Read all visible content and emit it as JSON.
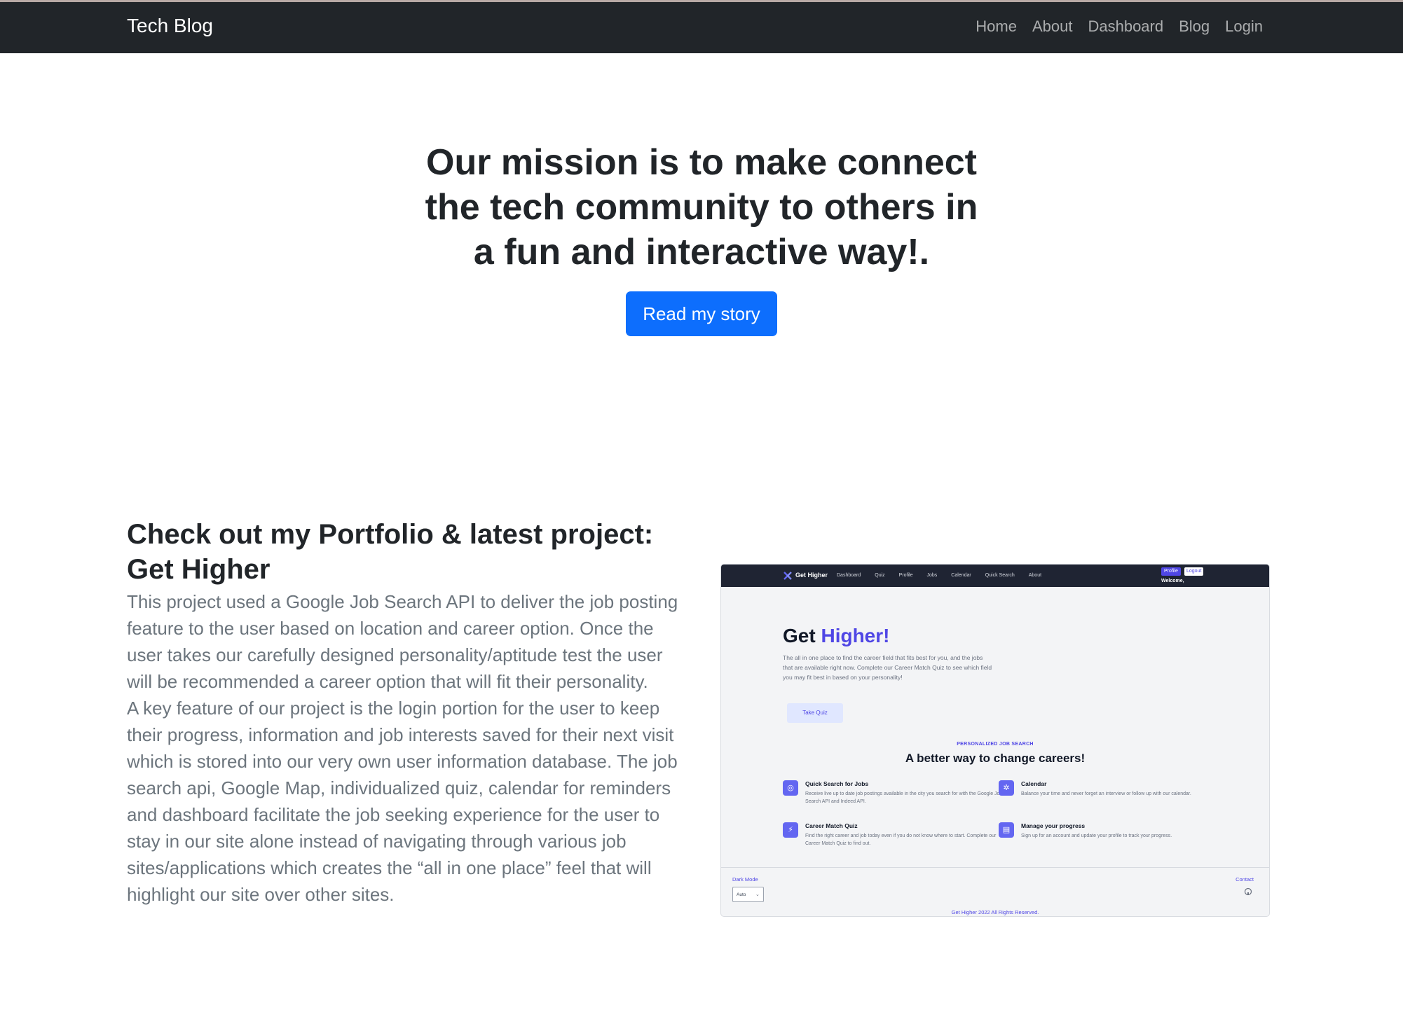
{
  "navbar": {
    "brand": "Tech Blog",
    "links": [
      "Home",
      "About",
      "Dashboard",
      "Blog",
      "Login"
    ]
  },
  "hero": {
    "title": "Our mission is to make connect the tech community to others in a fun and interactive way!.",
    "button": "Read my story"
  },
  "portfolio": {
    "title": "Check out my Portfolio & latest project: Get Higher",
    "paragraph_1": "This project used a Google Job Search API to deliver the job posting feature to the user based on location and career option. Once the user takes our carefully designed personality/aptitude test the user will be recommended a career option that will fit their personality.",
    "paragraph_2": "A key feature of our project is the login portion for the user to keep their progress, information and job interests saved for their next visit which is stored into our very own user information database. The job search api, Google Map, individualized quiz, calendar for reminders and dashboard facilitate the job seeking experience for the user to stay in our site alone instead of navigating through various job sites/applications which creates the “all in one place” feel that will highlight our site over other sites."
  },
  "screenshot": {
    "brand": "Get Higher",
    "links": [
      "Dashboard",
      "Quiz",
      "Profile",
      "Jobs",
      "Calendar",
      "Quick Search",
      "About"
    ],
    "profile": "Profile",
    "logout": "Logout",
    "welcome": "Welcome,",
    "heading_plain": "Get ",
    "heading_accent": "Higher!",
    "description": "The all in one place to find the career field that fits best for you, and the jobs that are available right now. Complete our Career Match Quiz to see which field you may fit best in based on your personality!",
    "quiz_button": "Take Quiz",
    "kicker": "PERSONALIZED JOB SEARCH",
    "subheading": "A better way to change careers!",
    "features": [
      {
        "title": "Quick Search for Jobs",
        "text": "Receive live up to date job postings available in the city you search for with the Google Job Search API and Indeed API."
      },
      {
        "title": "Calendar",
        "text": "Balance your time and never forget an interview or follow up with our calendar."
      },
      {
        "title": "Career Match Quiz",
        "text": "Find the right career and job today even if you do not know where to start. Complete our Career Match Quiz to find out."
      },
      {
        "title": "Manage your progress",
        "text": "Sign up for an account and update your profile to track your progress."
      }
    ],
    "dark_mode": "Dark Mode",
    "select_value": "Auto",
    "contact": "Contact",
    "copyright": "Get Higher 2022 All Rights Reserved.",
    "accent_color": "#4f46e5"
  },
  "colors": {
    "navbar_bg": "#212529",
    "primary_button": "#0d6efd",
    "body_text": "#6c757d"
  }
}
